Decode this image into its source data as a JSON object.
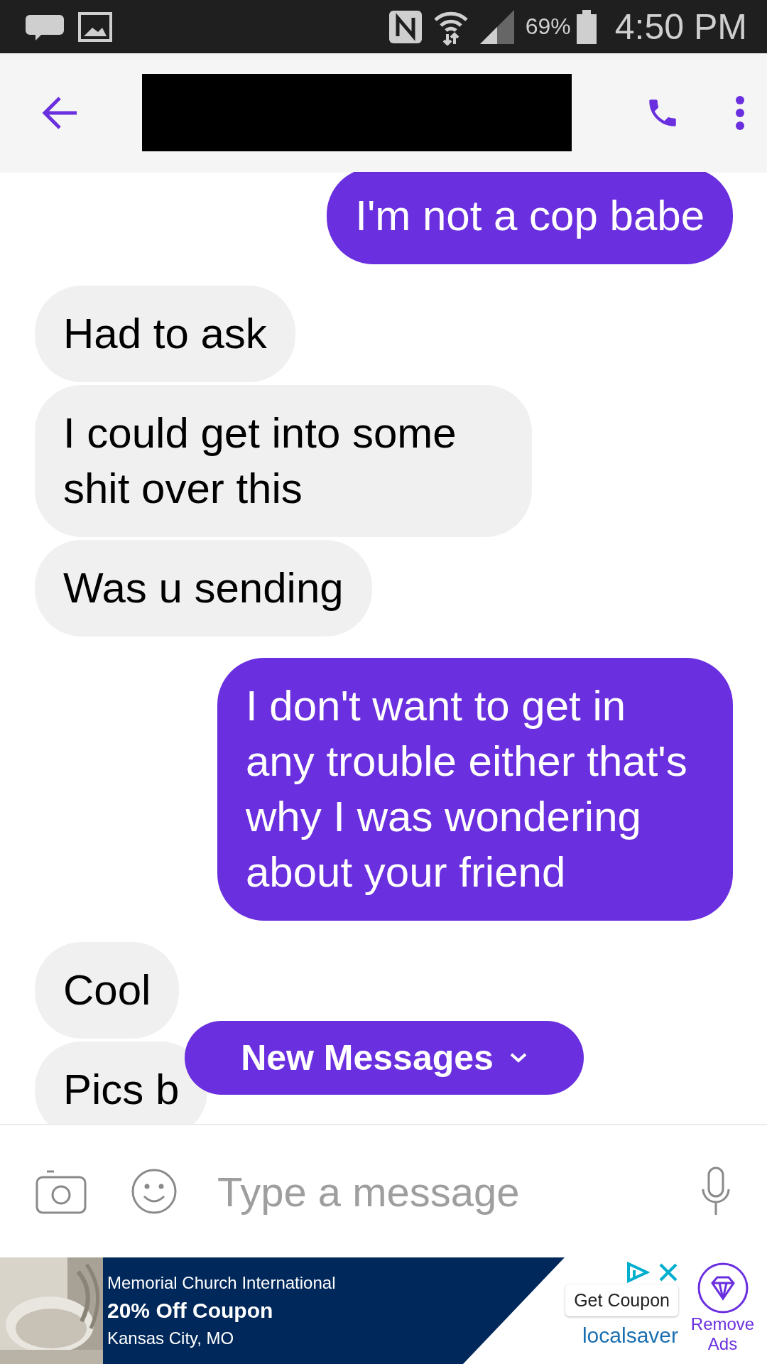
{
  "status_bar": {
    "battery": "69%",
    "time": "4:50 PM"
  },
  "messages": [
    {
      "kind": "sent",
      "text": "I'm not a cop babe"
    },
    {
      "kind": "received",
      "text": "Had to ask"
    },
    {
      "kind": "received",
      "text": "I could get into some shit over this"
    },
    {
      "kind": "received",
      "text": "Was u sending"
    },
    {
      "kind": "sent",
      "text": "I don't want to get in any trouble either that's why I was wondering about your friend"
    },
    {
      "kind": "received",
      "text": "Cool"
    },
    {
      "kind": "received",
      "text": "Pics b"
    }
  ],
  "new_messages": {
    "label": "New Messages"
  },
  "composer": {
    "placeholder": "Type a message"
  },
  "ad": {
    "advertiser": "Memorial Church International",
    "headline": "20% Off Coupon",
    "location": "Kansas City, MO",
    "cta": "Get Coupon",
    "brand": "localsaver"
  },
  "remove_ads": {
    "label": "Remove Ads"
  }
}
